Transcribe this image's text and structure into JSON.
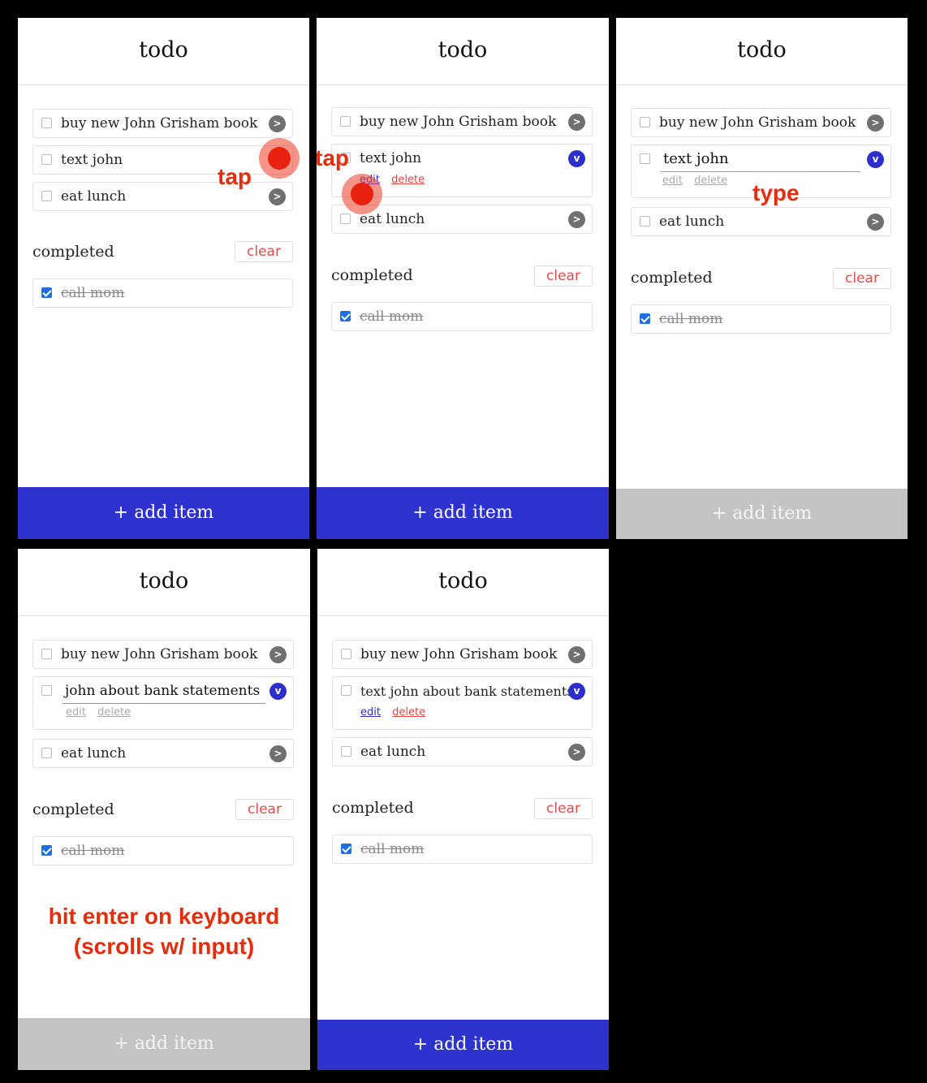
{
  "app_title": "todo",
  "completed_heading": "completed",
  "clear_label": "clear",
  "add_item_label": "+ add item",
  "chevron_closed_glyph": ">",
  "chevron_open_glyph": "v",
  "edit_label": "edit",
  "delete_label": "delete",
  "items": {
    "book": "buy new John Grisham book",
    "text_john": "text john",
    "lunch": "eat lunch",
    "call_mom": "call mom",
    "typing": "john about bank statements",
    "text_john_final": "text john about bank statements"
  },
  "annotations": {
    "tap1": "tap",
    "tap2": "tap",
    "type": "type",
    "enter": "hit enter on keyboard\n(scrolls w/ input)"
  },
  "colors": {
    "accent": "#2e32cf",
    "disabled": "#c4c4c4",
    "annotation": "#e52d0c",
    "clear_text": "#e74c4c",
    "checkbox_checked": "#1f6fe0"
  }
}
